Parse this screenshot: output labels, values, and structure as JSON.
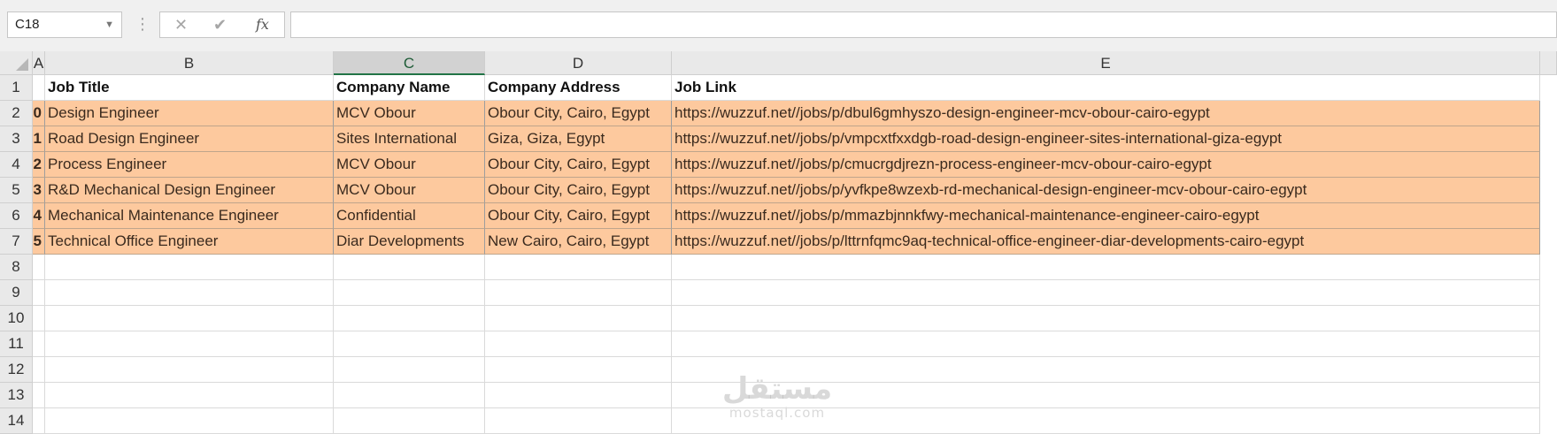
{
  "formula_bar": {
    "name_box": "C18",
    "name_box_icon": "chevron-down-icon",
    "cancel_icon": "✕",
    "confirm_icon": "✔",
    "function_label": "fx",
    "formula_value": ""
  },
  "columns": [
    "A",
    "B",
    "C",
    "D",
    "E"
  ],
  "rows": [
    "1",
    "2",
    "3",
    "4",
    "5",
    "6",
    "7",
    "8",
    "9",
    "10",
    "11",
    "12",
    "13",
    "14"
  ],
  "table": {
    "headers": [
      "",
      "Job Title",
      "Company Name",
      "Company Address",
      "Job Link"
    ],
    "records": [
      [
        "0",
        "Design Engineer",
        "MCV  Obour",
        "Obour City, Cairo, Egypt",
        "https://wuzzuf.net//jobs/p/dbul6gmhyszo-design-engineer-mcv-obour-cairo-egypt"
      ],
      [
        "1",
        "Road Design Engineer",
        "Sites International",
        "Giza, Giza, Egypt",
        "https://wuzzuf.net//jobs/p/vmpcxtfxxdgb-road-design-engineer-sites-international-giza-egypt"
      ],
      [
        "2",
        "Process Engineer",
        "MCV  Obour",
        "Obour City, Cairo, Egypt",
        "https://wuzzuf.net//jobs/p/cmucrgdjrezn-process-engineer-mcv-obour-cairo-egypt"
      ],
      [
        "3",
        "R&D Mechanical Design Engineer",
        "MCV  Obour",
        "Obour City, Cairo, Egypt",
        "https://wuzzuf.net//jobs/p/yvfkpe8wzexb-rd-mechanical-design-engineer-mcv-obour-cairo-egypt"
      ],
      [
        "4",
        "Mechanical Maintenance Engineer",
        "Confidential",
        "Obour City, Cairo, Egypt",
        "https://wuzzuf.net//jobs/p/mmazbjnnkfwy-mechanical-maintenance-engineer-cairo-egypt"
      ],
      [
        "5",
        "Technical Office Engineer",
        "Diar Developments",
        "New Cairo, Cairo, Egypt",
        "https://wuzzuf.net//jobs/p/lttrnfqmc9aq-technical-office-engineer-diar-developments-cairo-egypt"
      ]
    ]
  },
  "selected_column": "C",
  "colors": {
    "data_fill": "#fdc99e",
    "header_bg": "#e9e9e9",
    "selected_header_bg": "#d2d2d2",
    "accent": "#217346"
  },
  "watermark": {
    "arabic": "مستقل",
    "latin": "mostaql.com"
  }
}
